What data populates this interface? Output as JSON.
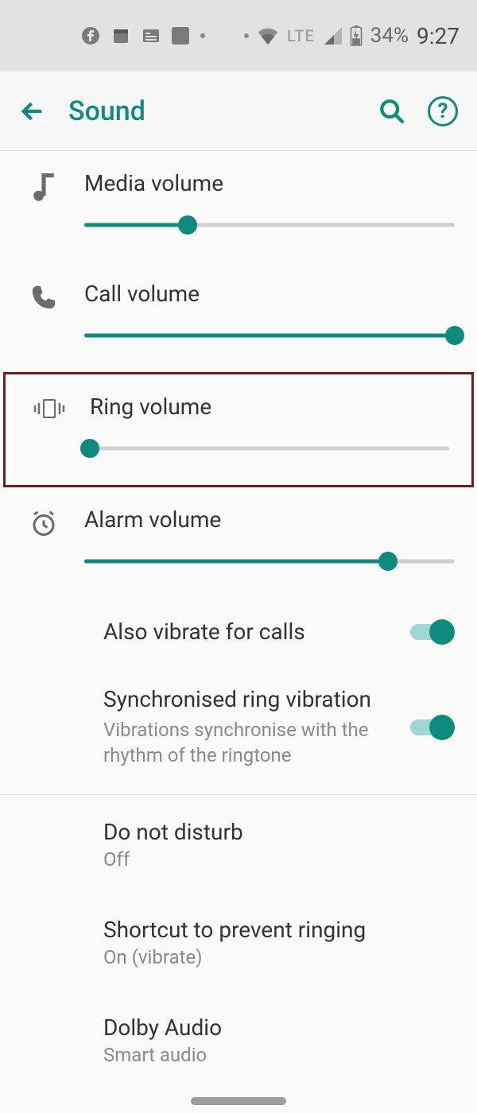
{
  "status": {
    "network_label": "LTE",
    "battery_percent": "34%",
    "time": "9:27"
  },
  "header": {
    "title": "Sound"
  },
  "sliders": {
    "media": {
      "label": "Media volume",
      "percent": 28
    },
    "call": {
      "label": "Call volume",
      "percent": 100
    },
    "ring": {
      "label": "Ring volume",
      "percent": 0
    },
    "alarm": {
      "label": "Alarm volume",
      "percent": 82
    }
  },
  "toggles": {
    "vibrate_calls": {
      "title": "Also vibrate for calls",
      "on": true
    },
    "sync_ring": {
      "title": "Synchronised ring vibration",
      "subtitle": "Vibrations synchronise with the rhythm of the ringtone",
      "on": true
    }
  },
  "prefs": {
    "dnd": {
      "title": "Do not disturb",
      "subtitle": "Off"
    },
    "shortcut": {
      "title": "Shortcut to prevent ringing",
      "subtitle": "On (vibrate)"
    },
    "dolby": {
      "title": "Dolby Audio",
      "subtitle": "Smart audio"
    }
  }
}
